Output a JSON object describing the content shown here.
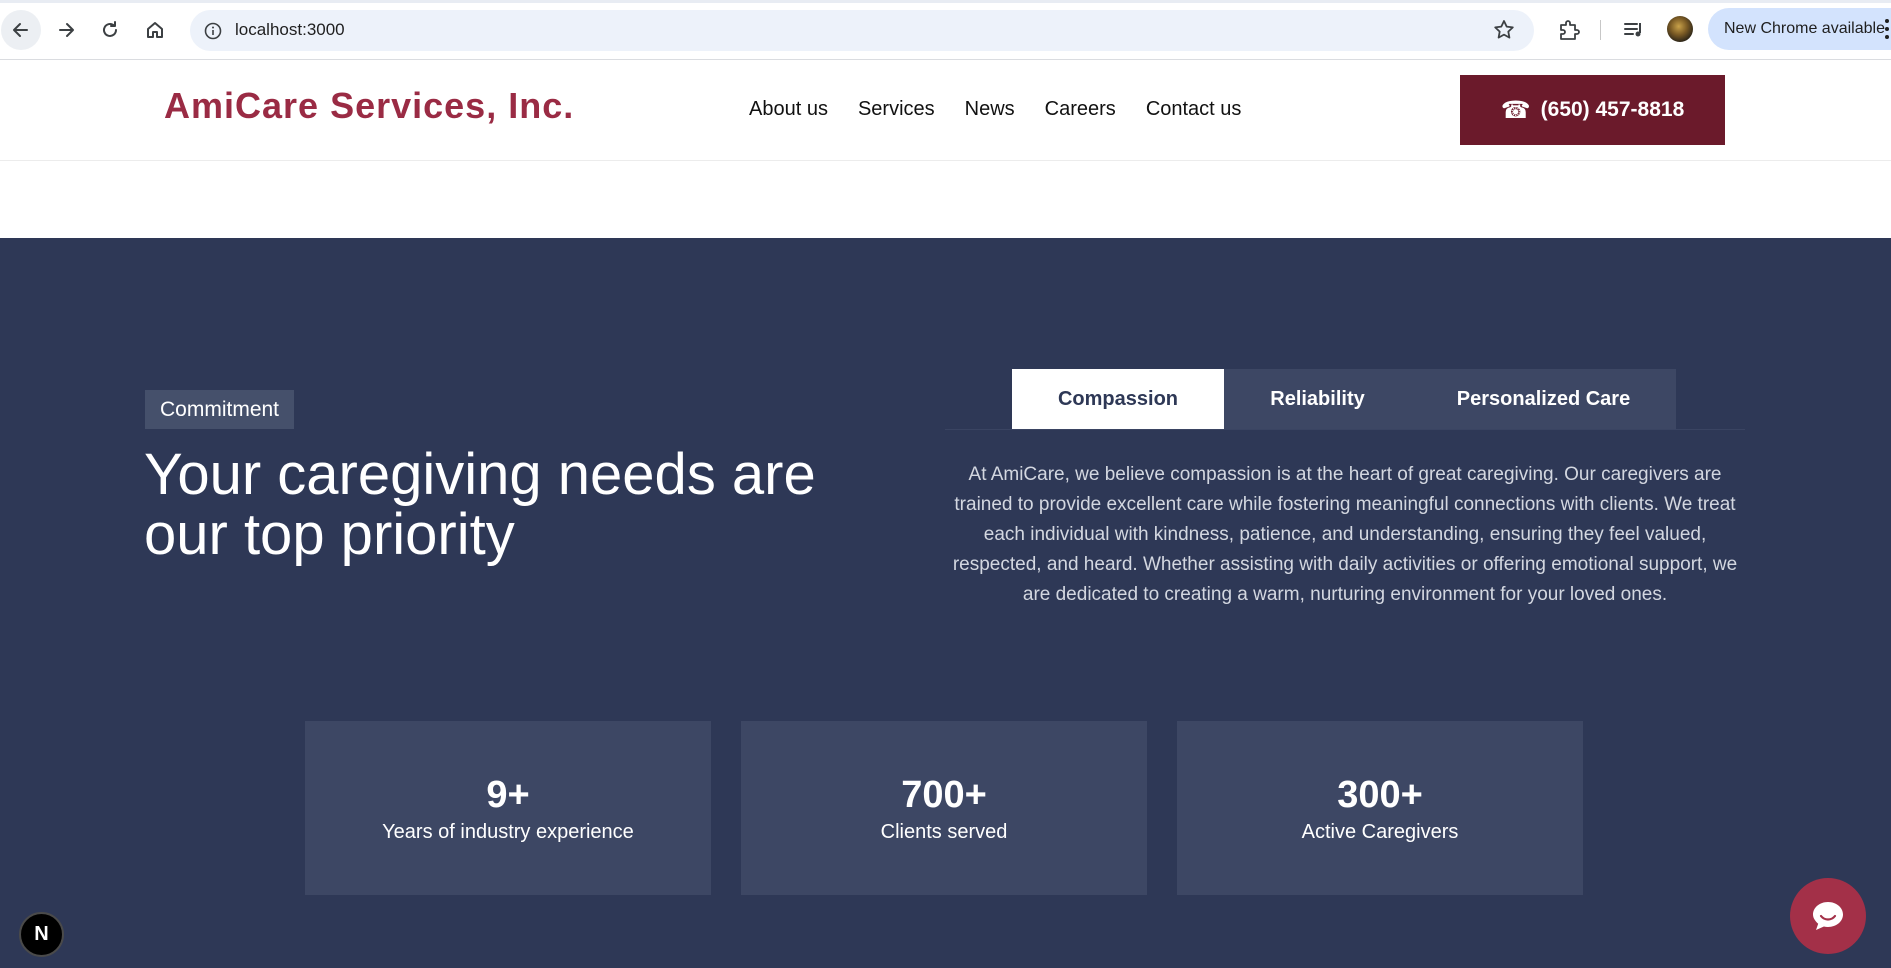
{
  "browser": {
    "url": "localhost:3000",
    "update_label": "New Chrome available"
  },
  "header": {
    "logo": "AmiCare Services, Inc.",
    "nav": [
      "About us",
      "Services",
      "News",
      "Careers",
      "Contact us"
    ],
    "phone": "(650) 457-8818"
  },
  "commitment": {
    "eyebrow": "Commitment",
    "headline": "Your caregiving needs are our top priority",
    "tabs": [
      "Compassion",
      "Reliability",
      "Personalized Care"
    ],
    "active_tab": "Compassion",
    "body": "At AmiCare, we believe compassion is at the heart of great caregiving. Our caregivers are trained to provide excellent care while fostering meaningful connections with clients. We treat each individual with kindness, patience, and understanding, ensuring they feel valued, respected, and heard. Whether assisting with daily activities or offering emotional support, we are dedicated to creating a warm, nurturing environment for your loved ones.",
    "stats": [
      {
        "value": "9+",
        "label": "Years of industry experience"
      },
      {
        "value": "700+",
        "label": "Clients served"
      },
      {
        "value": "300+",
        "label": "Active Caregivers"
      }
    ]
  },
  "widgets": {
    "dev_badge": "N"
  },
  "colors": {
    "brand": "#9a2b44",
    "phone_button": "#6b1a2b",
    "section_bg": "#2e3856",
    "card_bg": "#3d4764",
    "chat_bubble": "#a33048"
  }
}
